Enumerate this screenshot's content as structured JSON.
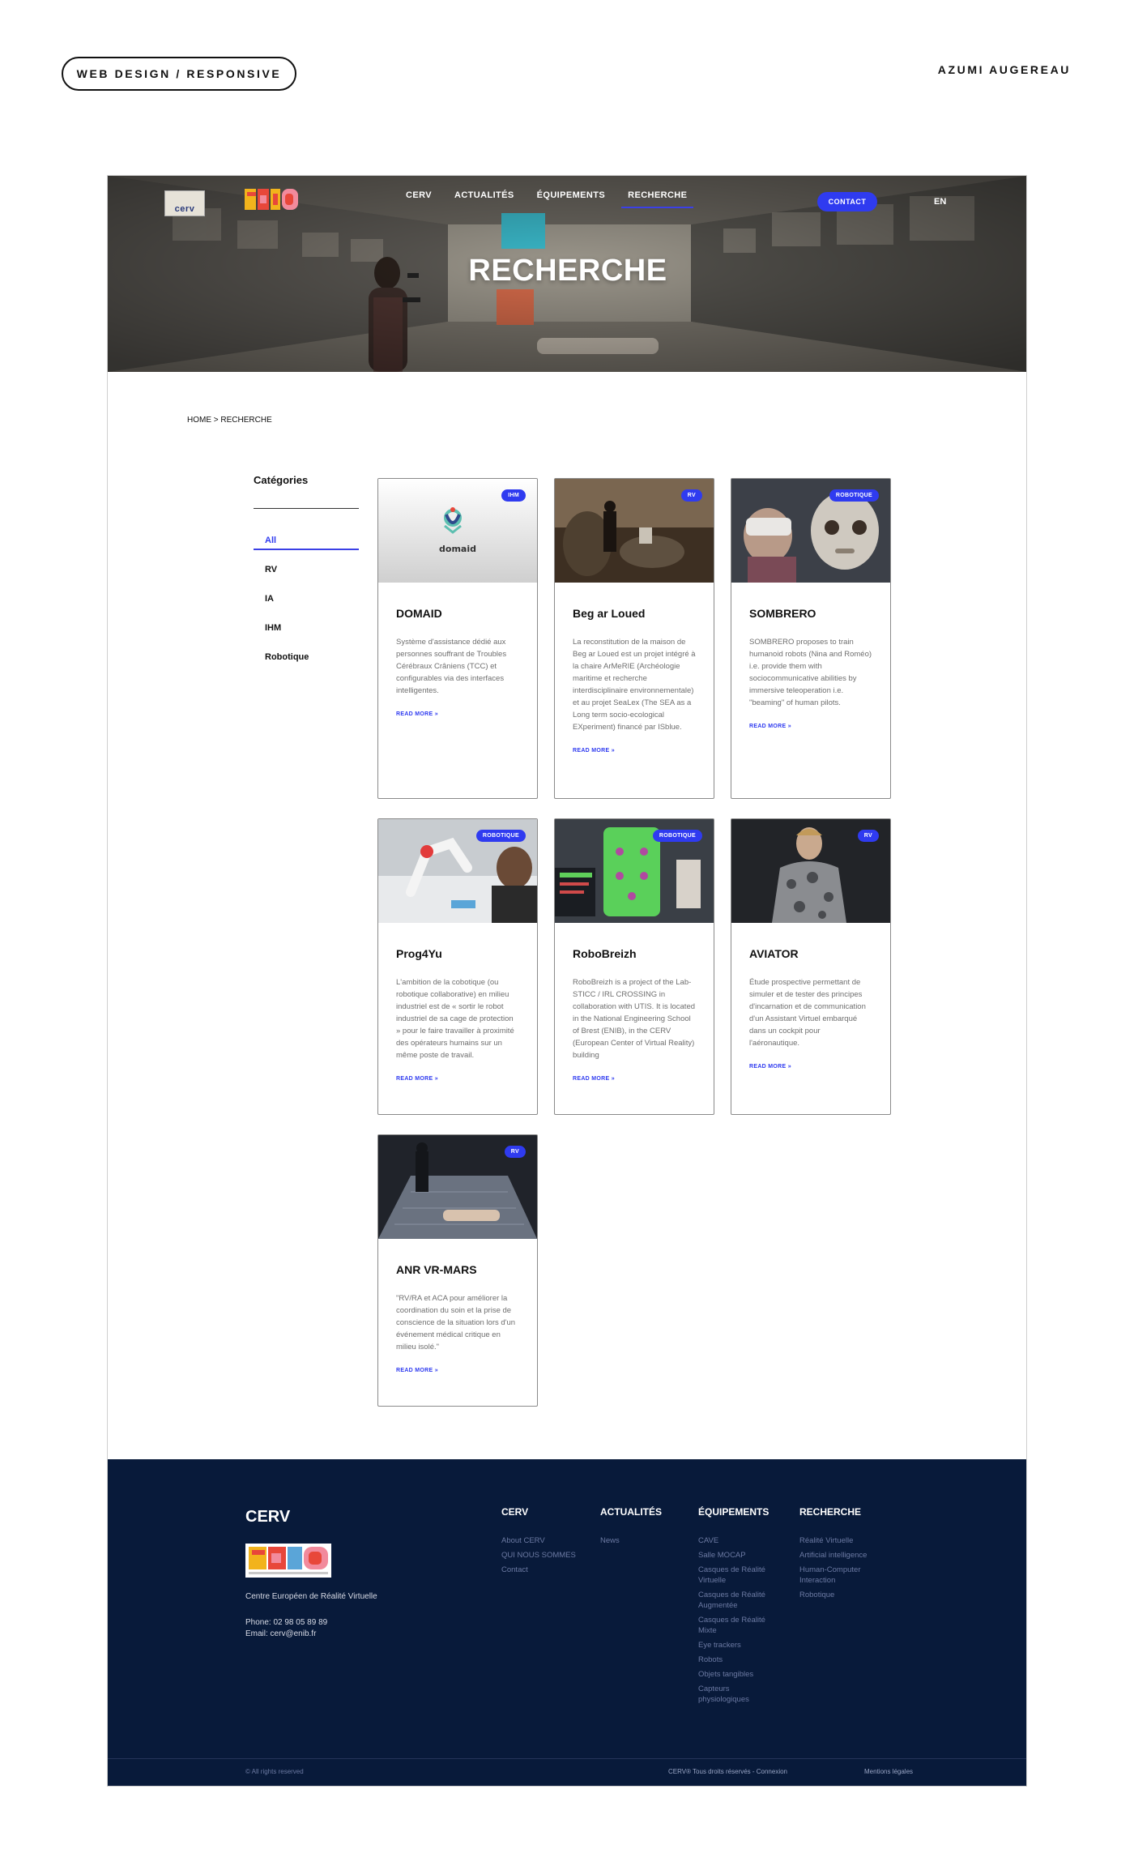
{
  "presentation": {
    "pill": "WEB DESIGN / RESPONSIVE",
    "author": "AZUMI AUGEREAU"
  },
  "header": {
    "logo_cerv_text": "cerv",
    "nav": [
      "CERV",
      "ACTUALITÉS",
      "ÉQUIPEMENTS",
      "RECHERCHE"
    ],
    "active_nav": "RECHERCHE",
    "contact_label": "CONTACT",
    "lang_label": "EN",
    "hero_title": "RECHERCHE"
  },
  "breadcrumb": "HOME > RECHERCHE",
  "sidebar": {
    "title": "Catégories",
    "categories": [
      "All",
      "RV",
      "IA",
      "IHM",
      "Robotique"
    ],
    "active": "All"
  },
  "cards": [
    {
      "title": "DOMAID",
      "badge": "IHM",
      "image": "domaid-logo",
      "description": "Système d'assistance dédié aux personnes souffrant de Troubles Cérébraux Crâniens (TCC) et configurables via des interfaces intelligentes.",
      "read_more": "READ MORE »",
      "logo_text": "domaid"
    },
    {
      "title": "Beg ar Loued",
      "badge": "RV",
      "image": "vr-user-stone-cave",
      "description": "La reconstitution de la maison de Beg ar Loued est un projet intégré à la chaire ArMeRIE (Archéologie maritime et recherche interdisciplinaire environnementale) et au projet SeaLex (The SEA as a Long term socio-ecological EXperiment) financé par ISblue.",
      "read_more": "READ MORE »"
    },
    {
      "title": "SOMBRERO",
      "badge": "ROBOTIQUE",
      "image": "humanoid-robot-headset",
      "description": "SOMBRERO proposes to train humanoid robots (Nina and Roméo) i.e. provide them with sociocommunicative abilities by immersive teleoperation i.e. \"beaming\" of human pilots.",
      "read_more": "READ MORE »"
    },
    {
      "title": "Prog4Yu",
      "badge": "ROBOTIQUE",
      "image": "collaborative-robot-arm",
      "description": "L'ambition de la cobotique (ou robotique collaborative) en milieu industriel est de « sortir le robot industriel de sa cage de protection » pour le faire travailler à proximité des opérateurs humains sur un même poste de travail.",
      "read_more": "READ MORE »"
    },
    {
      "title": "RoboBreizh",
      "badge": "ROBOTIQUE",
      "image": "robot-lab-screen",
      "description": "RoboBreizh is a project of the Lab-STICC / IRL CROSSING in collaboration with UTIS. It is located in the National Engineering School of Brest (ENIB), in the CERV (European Center of Virtual Reality) building",
      "read_more": "READ MORE »"
    },
    {
      "title": "AVIATOR",
      "badge": "RV",
      "image": "virtual-pilot-avatar",
      "description": "Étude prospective permettant de simuler et de tester des principes d'incarnation et de communication d'un Assistant Virtuel embarqué dans un cockpit pour l'aéronautique.",
      "read_more": "READ MORE »"
    },
    {
      "title": "ANR VR-MARS",
      "badge": "RV",
      "image": "vr-medical-patient",
      "description": "\"RV/RA et ACA pour améliorer la coordination du soin et la prise de conscience de la situation lors d'un événement médical critique en milieu isolé.\"",
      "read_more": "READ MORE »"
    }
  ],
  "footer": {
    "brand": "CERV",
    "tagline": "Centre Européen de Réalité Virtuelle",
    "phone": "Phone: 02 98 05 89 89",
    "email": "Email: cerv@enib.fr",
    "columns": [
      {
        "title": "CERV",
        "links": [
          "About CERV",
          "QUI NOUS SOMMES",
          "Contact"
        ]
      },
      {
        "title": "ACTUALITÉS",
        "links": [
          "News"
        ]
      },
      {
        "title": "ÉQUIPEMENTS",
        "links": [
          "CAVE",
          "Salle MOCAP",
          "Casques de Réalité Virtuelle",
          "Casques de Réalité Augmentée",
          "Casques de Réalité Mixte",
          "Eye trackers",
          "Robots",
          "Objets tangibles",
          "Capteurs physiologiques"
        ]
      },
      {
        "title": "RECHERCHE",
        "links": [
          "Réalité Virtuelle",
          "Artificial intelligence",
          "Human-Computer Interaction",
          "Robotique"
        ]
      }
    ],
    "copyright": "© All rights reserved",
    "rights_line": "CERV® Tous droits réservés - Connexion",
    "legal": "Mentions légales"
  },
  "colors": {
    "accent": "#2f3bf0",
    "footer_bg": "#081a3a",
    "text": "#111111"
  }
}
